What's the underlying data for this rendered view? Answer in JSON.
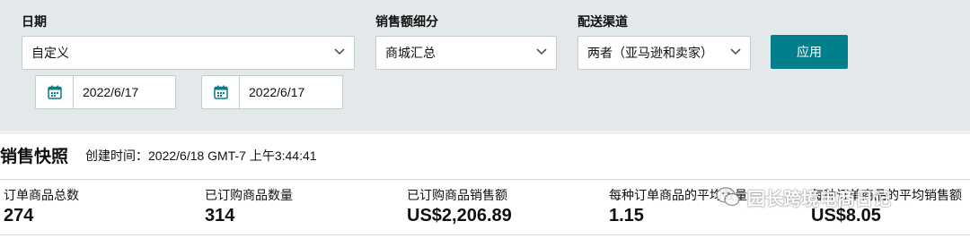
{
  "filters": {
    "date": {
      "label": "日期",
      "value": "自定义",
      "start": "2022/6/17",
      "end": "2022/6/17"
    },
    "breakdown": {
      "label": "销售额细分",
      "value": "商城汇总"
    },
    "channel": {
      "label": "配送渠道",
      "value": "两者（亚马逊和卖家）"
    },
    "apply_label": "应用"
  },
  "snapshot": {
    "title": "销售快照",
    "created": "创建时间：2022/6/18 GMT-7 上午3:44:41",
    "metrics": [
      {
        "label": "订单商品总数",
        "value": "274"
      },
      {
        "label": "已订购商品数量",
        "value": "314"
      },
      {
        "label": "已订购商品销售额",
        "value": "US$2,206.89"
      },
      {
        "label": "每种订单商品的平均数量",
        "value": "1.15"
      },
      {
        "label": "每种订单商品的平均销售额",
        "value": "US$8.05"
      }
    ]
  },
  "watermark": "园长跨境电商日记",
  "colors": {
    "filter_bg": "#e3e9ea",
    "apply_bg": "#037f8c",
    "icon": "#037f8c"
  }
}
